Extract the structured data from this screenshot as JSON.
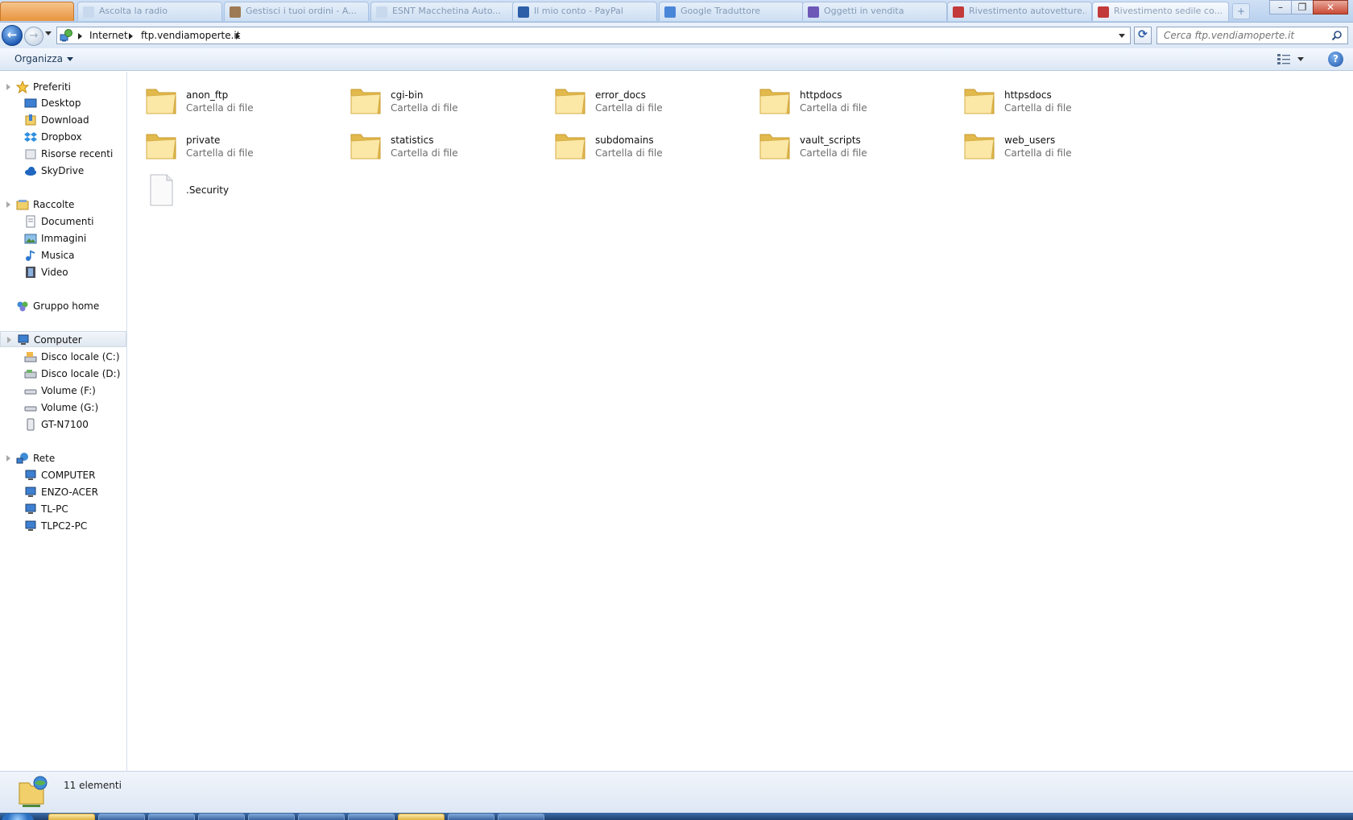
{
  "tabs": [
    {
      "label": "Ascolta la radio",
      "color": "#c8d9ee"
    },
    {
      "label": "Gestisci i tuoi ordini - A...",
      "color": "#9e7a54"
    },
    {
      "label": "ESNT Macchetina Auto...",
      "color": "#c8d9ee"
    },
    {
      "label": "Il mio conto - PayPal",
      "color": "#2d5fa8"
    },
    {
      "label": "Google Traduttore",
      "color": "#4a86d8"
    },
    {
      "label": "Oggetti in vendita",
      "color": "#6d58b8"
    },
    {
      "label": "Rivestimento autovetture...",
      "color": "#c23a3a"
    },
    {
      "label": "Rivestimento sedile co...",
      "color": "#c23a3a"
    }
  ],
  "window": {
    "minimize_glyph": "–",
    "maximize_glyph": "❐",
    "close_glyph": "✕",
    "new_tab_glyph": "+"
  },
  "address": {
    "back_glyph": "←",
    "forward_glyph": "→",
    "crumbs": [
      "Internet",
      "ftp.vendiamoperte.it"
    ],
    "refresh_glyph": "⟳",
    "search_placeholder": "Cerca ftp.vendiamoperte.it"
  },
  "toolbar": {
    "organize_label": "Organizza",
    "help_glyph": "?"
  },
  "navigation": {
    "favorites": {
      "label": "Preferiti",
      "items": [
        "Desktop",
        "Download",
        "Dropbox",
        "Risorse recenti",
        "SkyDrive"
      ]
    },
    "libraries": {
      "label": "Raccolte",
      "items": [
        "Documenti",
        "Immagini",
        "Musica",
        "Video"
      ]
    },
    "homegroup": {
      "label": "Gruppo home"
    },
    "computer": {
      "label": "Computer",
      "items": [
        "Disco locale (C:)",
        "Disco locale (D:)",
        "Volume (F:)",
        "Volume (G:)",
        "GT-N7100"
      ]
    },
    "network": {
      "label": "Rete",
      "items": [
        "COMPUTER",
        "ENZO-ACER",
        "TL-PC",
        "TLPC2-PC"
      ]
    }
  },
  "files": [
    {
      "name": "anon_ftp",
      "type": "Cartella di file",
      "kind": "folder"
    },
    {
      "name": "cgi-bin",
      "type": "Cartella di file",
      "kind": "folder"
    },
    {
      "name": "error_docs",
      "type": "Cartella di file",
      "kind": "folder"
    },
    {
      "name": "httpdocs",
      "type": "Cartella di file",
      "kind": "folder"
    },
    {
      "name": "httpsdocs",
      "type": "Cartella di file",
      "kind": "folder"
    },
    {
      "name": "private",
      "type": "Cartella di file",
      "kind": "folder"
    },
    {
      "name": "statistics",
      "type": "Cartella di file",
      "kind": "folder"
    },
    {
      "name": "subdomains",
      "type": "Cartella di file",
      "kind": "folder"
    },
    {
      "name": "vault_scripts",
      "type": "Cartella di file",
      "kind": "folder"
    },
    {
      "name": "web_users",
      "type": "Cartella di file",
      "kind": "folder"
    },
    {
      "name": ".Security",
      "type": "",
      "kind": "file"
    }
  ],
  "status": {
    "count_label": "11 elementi"
  },
  "colors": {
    "folder_light": "#fbe7a6",
    "folder_dark": "#e2b94c",
    "accent_blue": "#1f5db5",
    "close_red": "#c94a35"
  }
}
